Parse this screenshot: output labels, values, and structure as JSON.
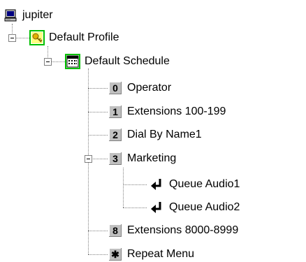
{
  "tree": {
    "root": {
      "label": "jupiter",
      "icon": "computer-icon"
    },
    "profile": {
      "label": "Default Profile",
      "icon": "profile-key-icon"
    },
    "schedule": {
      "label": "Default Schedule",
      "icon": "schedule-icon"
    },
    "menu_items": [
      {
        "key": "0",
        "label": "Operator"
      },
      {
        "key": "1",
        "label": "Extensions 100-199"
      },
      {
        "key": "2",
        "label": "Dial By Name1"
      },
      {
        "key": "3",
        "label": "Marketing"
      },
      {
        "key": "8",
        "label": "Extensions 8000-8999"
      },
      {
        "key": "✱",
        "label": "Repeat Menu"
      }
    ],
    "queue_items": [
      {
        "label": "Queue Audio1",
        "icon": "return-arrow-icon"
      },
      {
        "label": "Queue Audio2",
        "icon": "return-arrow-icon"
      }
    ]
  }
}
